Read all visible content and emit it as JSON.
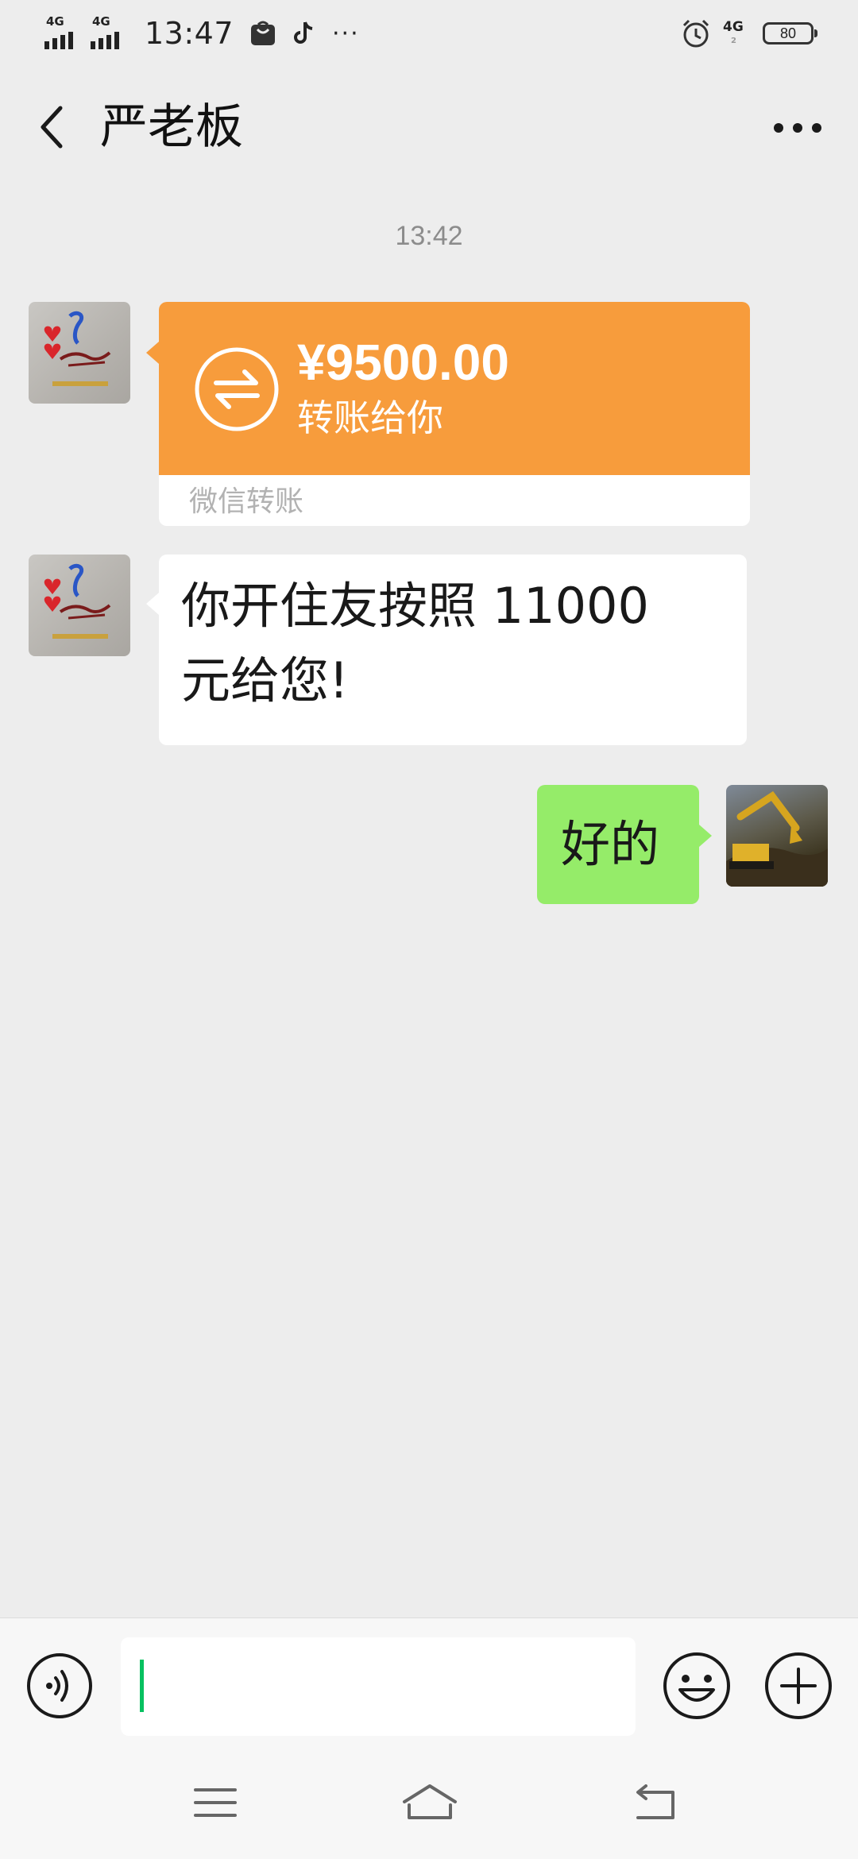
{
  "status_bar": {
    "signal1_type": "4G",
    "signal2_type": "4G",
    "time": "13:47",
    "more": "···",
    "network2": "4G",
    "network2_sub": "2",
    "battery": "80",
    "icons": [
      "signal-icon",
      "signal-icon",
      "shopping-bag-icon",
      "tiktok-icon",
      "alarm-clock-icon",
      "battery-icon"
    ]
  },
  "header": {
    "title": "严老板",
    "back_icon": "chevron-left-icon",
    "more_icon": "more-horizontal-icon"
  },
  "chat": {
    "timestamp": "13:42",
    "messages": [
      {
        "kind": "transfer",
        "from": "contact",
        "amount": "¥9500.00",
        "description": "转账给你",
        "footer": "微信转账",
        "icon": "transfer-arrows-icon"
      },
      {
        "kind": "text",
        "from": "contact",
        "lines": [
          "你开住友按照 11000",
          "元给您!"
        ]
      },
      {
        "kind": "text",
        "from": "self",
        "text": "好的"
      }
    ]
  },
  "input_bar": {
    "value": "",
    "icons": [
      "voice-icon",
      "emoji-icon",
      "plus-icon"
    ]
  },
  "nav_bar": {
    "icons": [
      "menu-icon",
      "home-icon",
      "back-icon"
    ]
  },
  "colors": {
    "background": "#ededed",
    "transfer_card": "#f79c3c",
    "self_bubble": "#95ec69",
    "contact_bubble": "#ffffff",
    "caret": "#07c160",
    "timestamp_text": "#8c8c8c"
  }
}
